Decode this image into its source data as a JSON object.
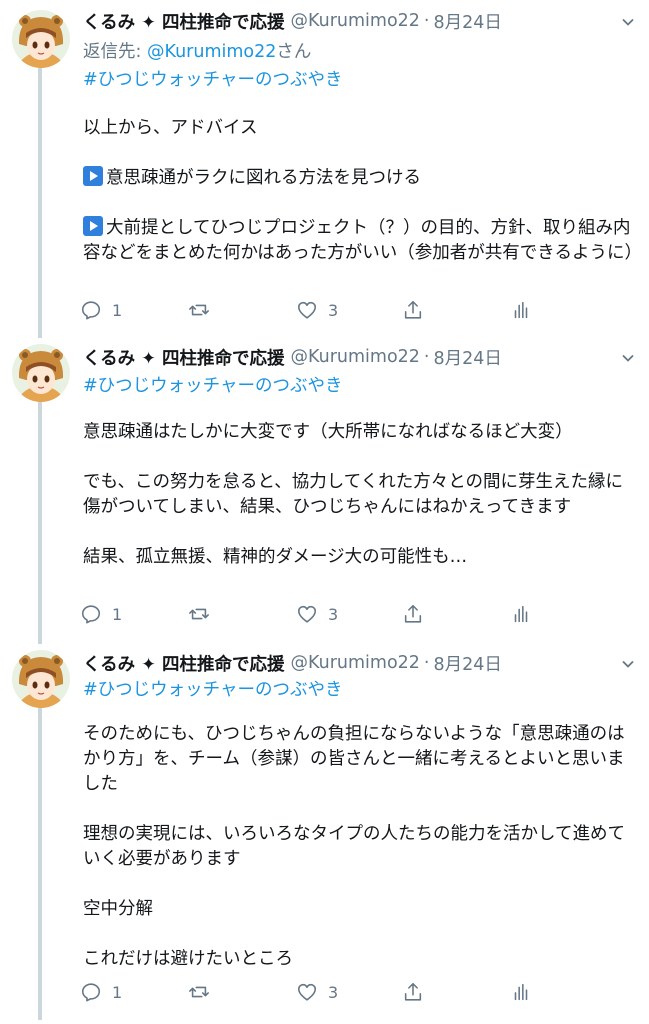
{
  "colors": {
    "link": "#1b95e0",
    "muted": "#657786",
    "text": "#14171a",
    "thread_line": "#ccd6dd"
  },
  "tweets": [
    {
      "name": "くるみ ✦ 四柱推命で応援",
      "handle": "@Kurumimo22",
      "date": "8月24日",
      "reply_prefix": "返信先: ",
      "reply_mention": "@Kurumimo22",
      "reply_suffix": "さん",
      "hashtag": "#ひつじウォッチャーのつぶやき",
      "paragraphs": [
        "以上から、アドバイス",
        "意思疎通がラクに図れる方法を見つける",
        "大前提としてひつじプロジェクト（？）の目的、方針、取り組み内容などをまとめた何かはあった方がいい（参加者が共有できるように）"
      ],
      "replies": "1",
      "likes": "3"
    },
    {
      "name": "くるみ ✦ 四柱推命で応援",
      "handle": "@Kurumimo22",
      "date": "8月24日",
      "hashtag": "#ひつじウォッチャーのつぶやき",
      "paragraphs": [
        "意思疎通はたしかに大変です（大所帯になればなるほど大変）",
        "でも、この努力を怠ると、協力してくれた方々との間に芽生えた縁に傷がついてしまい、結果、ひつじちゃんにはねかえってきます",
        "結果、孤立無援、精神的ダメージ大の可能性も…"
      ],
      "replies": "1",
      "likes": "3"
    },
    {
      "name": "くるみ ✦ 四柱推命で応援",
      "handle": "@Kurumimo22",
      "date": "8月24日",
      "hashtag": "#ひつじウォッチャーのつぶやき",
      "paragraphs": [
        "そのためにも、ひつじちゃんの負担にならないような「意思疎通のはかり方」を、チーム（参謀）の皆さんと一緒に考えるとよいと思いました",
        "理想の実現には、いろいろなタイプの人たちの能力を活かして進めていく必要があります",
        "空中分解",
        "これだけは避けたいところ"
      ],
      "replies": "1",
      "likes": "3"
    }
  ]
}
